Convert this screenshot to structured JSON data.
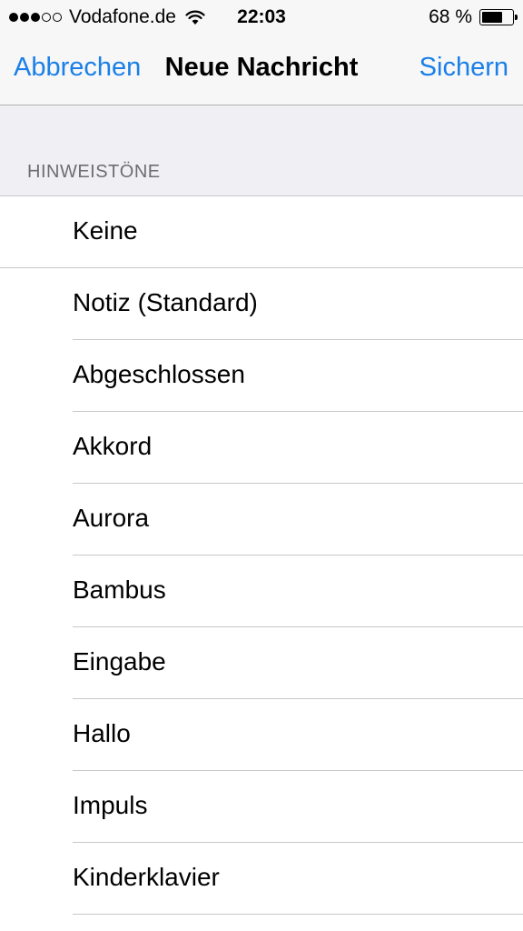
{
  "status_bar": {
    "carrier": "Vodafone.de",
    "time": "22:03",
    "battery": "68 %",
    "battery_level": 0.68,
    "signal_bars": 3,
    "signal_max": 5
  },
  "nav": {
    "cancel_label": "Abbrechen",
    "title": "Neue Nachricht",
    "save_label": "Sichern"
  },
  "section": {
    "header": "HINWEISTÖNE"
  },
  "tones": [
    {
      "label": "Keine"
    },
    {
      "label": "Notiz (Standard)"
    },
    {
      "label": "Abgeschlossen"
    },
    {
      "label": "Akkord"
    },
    {
      "label": "Aurora"
    },
    {
      "label": "Bambus"
    },
    {
      "label": "Eingabe"
    },
    {
      "label": "Hallo"
    },
    {
      "label": "Impuls"
    },
    {
      "label": "Kinderklavier"
    }
  ],
  "colors": {
    "accent": "#1a7fe8",
    "group_background": "#efeff4",
    "bar_background": "#f7f7f7"
  }
}
